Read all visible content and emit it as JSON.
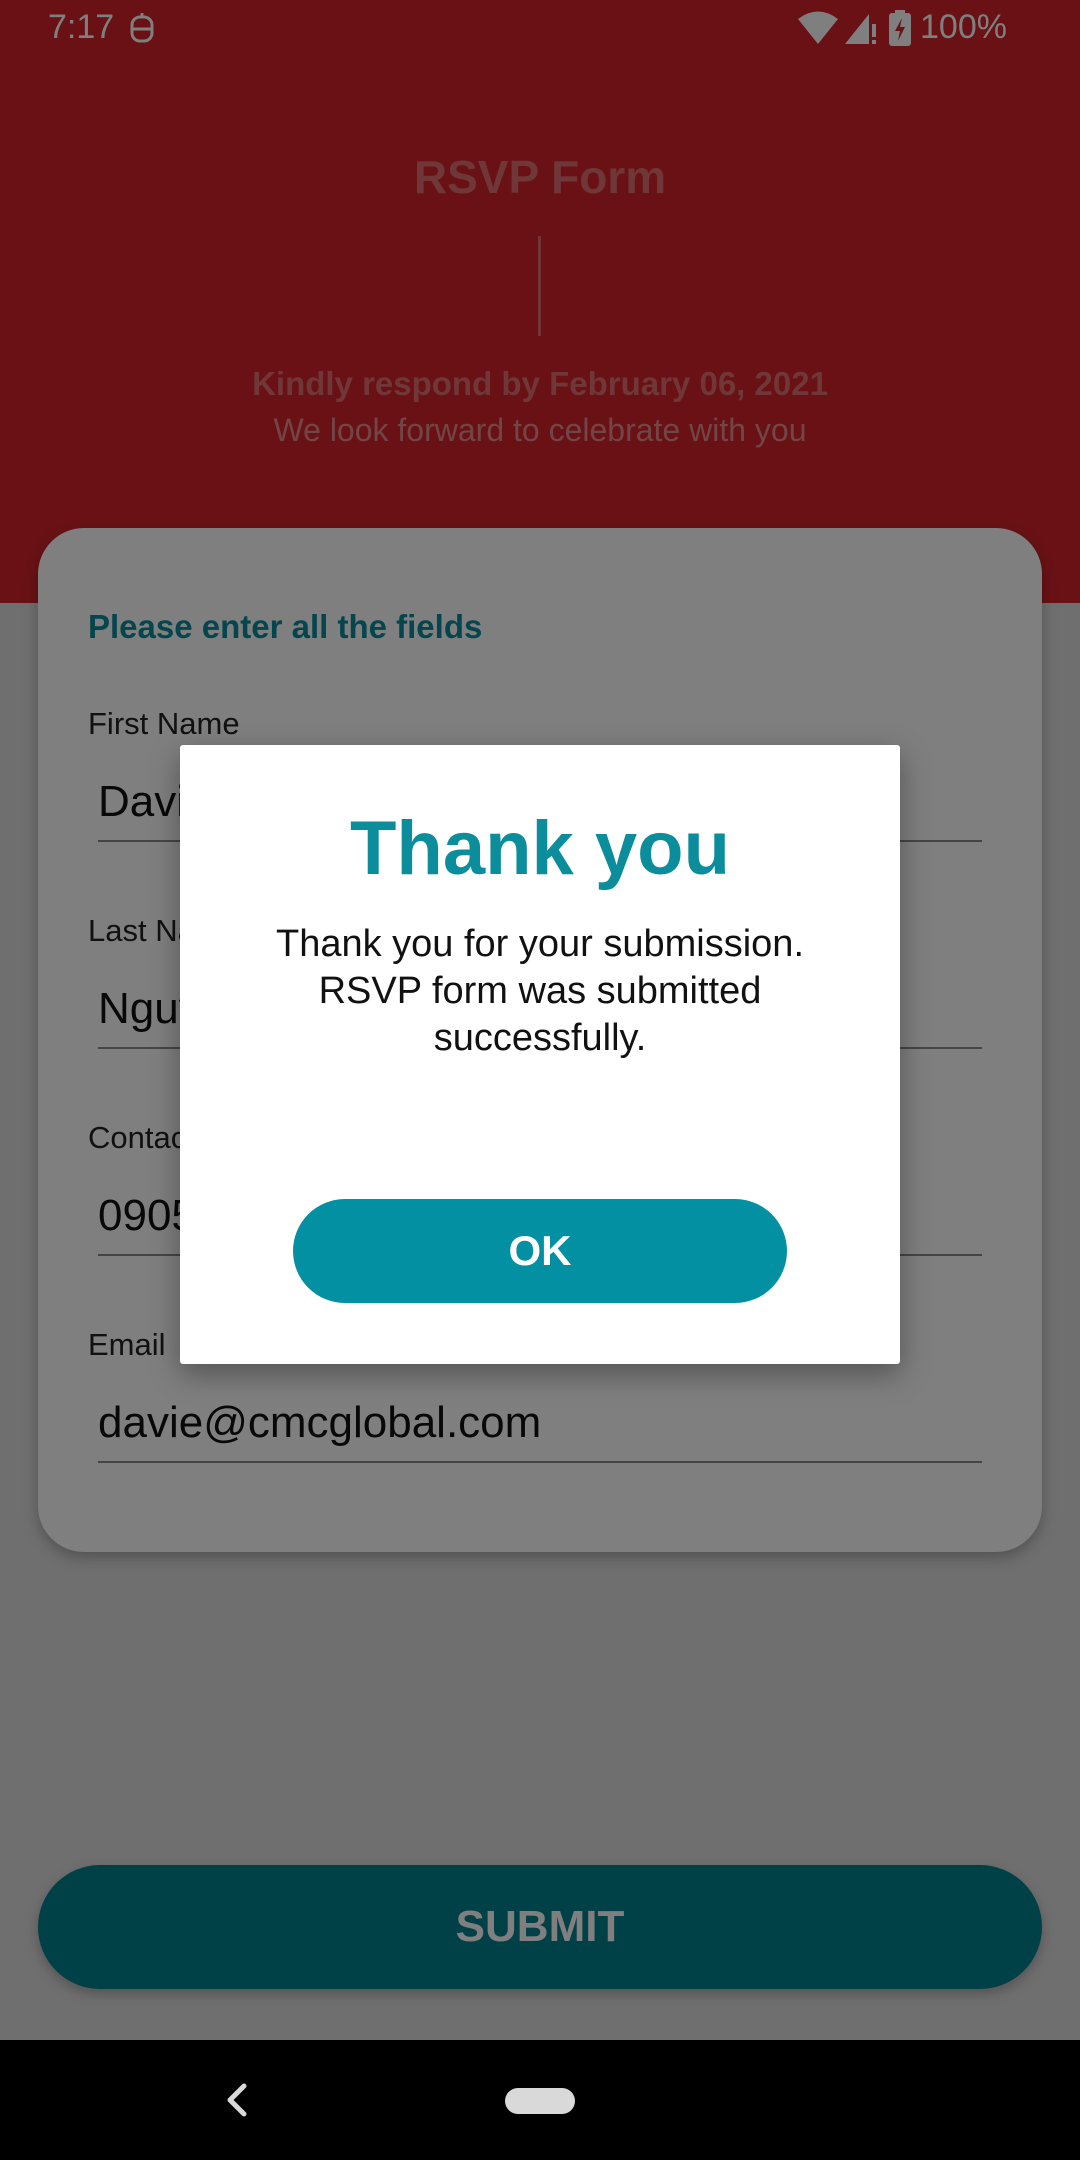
{
  "status_bar": {
    "time": "7:17",
    "battery": "100%"
  },
  "header": {
    "title": "RSVP Form",
    "deadline": "Kindly respond by February 06, 2021",
    "subtitle": "We look forward to celebrate with you"
  },
  "form": {
    "heading": "Please enter all the fields",
    "fields": [
      {
        "label": "First Name",
        "value": "Davie"
      },
      {
        "label": "Last Name",
        "value": "Nguyen"
      },
      {
        "label": "Contact",
        "value": "0905"
      },
      {
        "label": "Email",
        "value": "davie@cmcglobal.com"
      }
    ],
    "submit_label": "SUBMIT"
  },
  "dialog": {
    "title": "Thank you",
    "message": "Thank you for your submission.\nRSVP form was submitted\nsuccessfully.",
    "ok_label": "OK"
  },
  "colors": {
    "header": "#d2232a",
    "accent": "#0290a2",
    "submit": "#00808e"
  },
  "icons": [
    "app-notification-icon",
    "wifi-icon",
    "signal-icon",
    "battery-icon",
    "back-icon"
  ]
}
